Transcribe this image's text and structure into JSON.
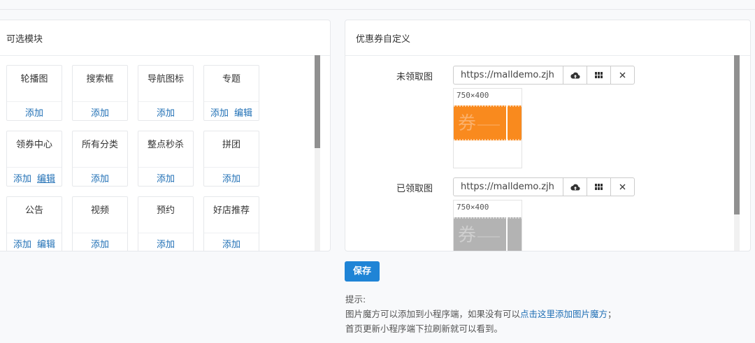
{
  "left_panel": {
    "title": "可选模块",
    "modules": [
      {
        "name": "轮播图",
        "actions": [
          "添加"
        ]
      },
      {
        "name": "搜索框",
        "actions": [
          "添加"
        ]
      },
      {
        "name": "导航图标",
        "actions": [
          "添加"
        ]
      },
      {
        "name": "专题",
        "actions": [
          "添加",
          "编辑"
        ]
      },
      {
        "name": "领券中心",
        "actions": [
          "添加",
          "编辑"
        ]
      },
      {
        "name": "所有分类",
        "actions": [
          "添加"
        ]
      },
      {
        "name": "整点秒杀",
        "actions": [
          "添加"
        ]
      },
      {
        "name": "拼团",
        "actions": [
          "添加"
        ]
      },
      {
        "name": "公告",
        "actions": [
          "添加",
          "编辑"
        ]
      },
      {
        "name": "视频",
        "actions": [
          "添加"
        ]
      },
      {
        "name": "预约",
        "actions": [
          "添加"
        ]
      },
      {
        "name": "好店推荐",
        "actions": [
          "添加"
        ]
      }
    ]
  },
  "right_panel": {
    "title": "优惠券自定义",
    "fields": [
      {
        "label": "未领取图",
        "value": "https://malldemo.zjh",
        "size": "750×400",
        "coupon_color": "#f98a1e",
        "coupon_text": "券"
      },
      {
        "label": "已领取图",
        "value": "https://malldemo.zjh",
        "size": "750×400",
        "coupon_color": "#b3b3b3",
        "coupon_text": "券"
      }
    ],
    "icons": [
      "cloud-upload-icon",
      "grid-icon",
      "close-icon"
    ]
  },
  "save_label": "保存",
  "tips": {
    "heading": "提示:",
    "line1_before": "图片魔方可以添加到小程序端，如果没有可以",
    "line1_link": "点击这里添加图片魔方",
    "line1_after": "；",
    "line2": "首页更新小程序端下拉刷新就可以看到。"
  },
  "colors": {
    "link": "#1f6fb5",
    "primary": "#1f84d6",
    "coupon_active": "#f98a1e",
    "coupon_used": "#b3b3b3"
  }
}
